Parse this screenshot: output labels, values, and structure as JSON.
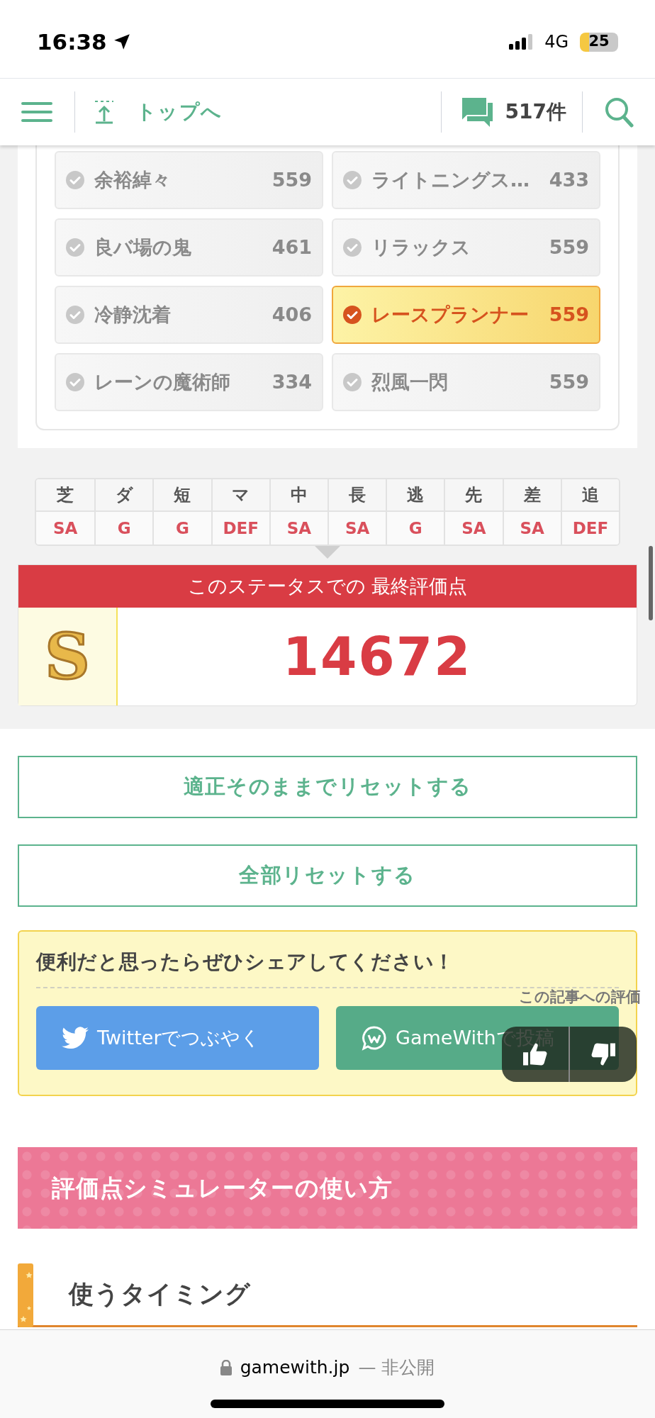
{
  "status_bar": {
    "time": "16:38",
    "network": "4G",
    "battery": "25"
  },
  "header": {
    "top_link": "トップへ",
    "comments": "517件"
  },
  "skills": [
    {
      "name": "余裕綽々",
      "points": "559",
      "selected": false
    },
    {
      "name": "ライトニングス…",
      "points": "433",
      "selected": false
    },
    {
      "name": "良バ場の鬼",
      "points": "461",
      "selected": false
    },
    {
      "name": "リラックス",
      "points": "559",
      "selected": false
    },
    {
      "name": "冷静沈着",
      "points": "406",
      "selected": false
    },
    {
      "name": "レースプランナー",
      "points": "559",
      "selected": true
    },
    {
      "name": "レーンの魔術師",
      "points": "334",
      "selected": false
    },
    {
      "name": "烈風一閃",
      "points": "559",
      "selected": false
    }
  ],
  "aptitudes": [
    {
      "label": "芝",
      "grade": "SA"
    },
    {
      "label": "ダ",
      "grade": "G"
    },
    {
      "label": "短",
      "grade": "G"
    },
    {
      "label": "マ",
      "grade": "DEF"
    },
    {
      "label": "中",
      "grade": "SA"
    },
    {
      "label": "長",
      "grade": "SA"
    },
    {
      "label": "逃",
      "grade": "G"
    },
    {
      "label": "先",
      "grade": "SA"
    },
    {
      "label": "差",
      "grade": "SA"
    },
    {
      "label": "追",
      "grade": "DEF"
    }
  ],
  "score": {
    "title": "このステータスでの 最終評価点",
    "rank": "S",
    "value": "14672"
  },
  "reset_buttons": [
    "適正そのままでリセットする",
    "全部リセットする"
  ],
  "share": {
    "title": "便利だと思ったらぜひシェアしてください！",
    "buttons": [
      {
        "kind": "twitter",
        "label": "Twitterでつぶやく"
      },
      {
        "kind": "gamewith",
        "label": "GameWithで投稿"
      }
    ]
  },
  "rating": {
    "label": "この記事への評価"
  },
  "section_heading": "評価点シミュレーターの使い方",
  "sub_heading": "使うタイミング",
  "browser": {
    "domain": "gamewith.jp",
    "suffix": "— 非公開"
  }
}
